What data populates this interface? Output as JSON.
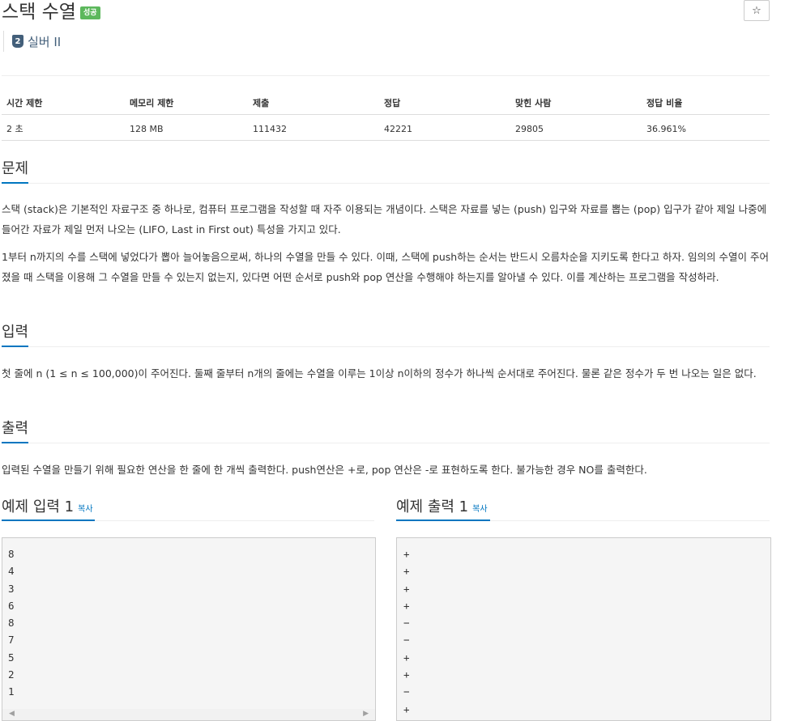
{
  "problem": {
    "title": "스택 수열",
    "badge": "성공",
    "tier_number": "2",
    "tier_label": "실버 II",
    "star": "☆"
  },
  "info_table": {
    "headers": [
      "시간 제한",
      "메모리 제한",
      "제출",
      "정답",
      "맞힌 사람",
      "정답 비율"
    ],
    "values": [
      "2 초",
      "128 MB",
      "111432",
      "42221",
      "29805",
      "36.961%"
    ]
  },
  "sections": {
    "problem_title": "문제",
    "problem_p1": "스택 (stack)은 기본적인 자료구조 중 하나로, 컴퓨터 프로그램을 작성할 때 자주 이용되는 개념이다. 스택은 자료를 넣는 (push) 입구와 자료를 뽑는 (pop) 입구가 같아 제일 나중에 들어간 자료가 제일 먼저 나오는 (LIFO, Last in First out) 특성을 가지고 있다.",
    "problem_p2": "1부터 n까지의 수를 스택에 넣었다가 뽑아 늘어놓음으로써, 하나의 수열을 만들 수 있다. 이때, 스택에 push하는 순서는 반드시 오름차순을 지키도록 한다고 하자. 임의의 수열이 주어졌을 때 스택을 이용해 그 수열을 만들 수 있는지 없는지, 있다면 어떤 순서로 push와 pop 연산을 수행해야 하는지를 알아낼 수 있다. 이를 계산하는 프로그램을 작성하라.",
    "input_title": "입력",
    "input_p": "첫 줄에 n (1 ≤ n ≤ 100,000)이 주어진다. 둘째 줄부터 n개의 줄에는 수열을 이루는 1이상 n이하의 정수가 하나씩 순서대로 주어진다. 물론 같은 정수가 두 번 나오는 일은 없다.",
    "output_title": "출력",
    "output_p": "입력된 수열을 만들기 위해 필요한 연산을 한 줄에 한 개씩 출력한다. push연산은 +로, pop 연산은 -로 표현하도록 한다. 불가능한 경우 NO를 출력한다."
  },
  "sample_input": {
    "title": "예제 입력 1",
    "copy": "복사",
    "lines": [
      "8",
      "4",
      "3",
      "6",
      "8",
      "7",
      "5",
      "2",
      "1"
    ]
  },
  "sample_output": {
    "title": "예제 출력 1",
    "copy": "복사",
    "lines": [
      "+",
      "+",
      "+",
      "+",
      "−",
      "−",
      "+",
      "+",
      "−",
      "+"
    ]
  },
  "colors": {
    "accent": "#0076c0",
    "badge_green": "#5cb85c",
    "tier_silver": "#435f7a"
  }
}
